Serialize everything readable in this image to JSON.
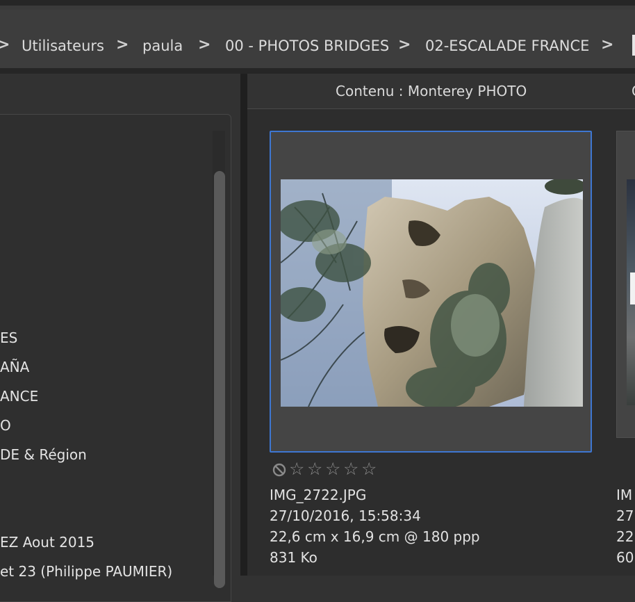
{
  "breadcrumb": {
    "items": [
      "Utilisateurs",
      "paula",
      "00 - PHOTOS BRIDGES",
      "02-ESCALADE FRANCE"
    ],
    "separator": ">"
  },
  "folders": {
    "items": [
      "ES",
      "AÑA",
      "ANCE",
      "O",
      "DE & Région",
      "EZ Aout 2015",
      "et 23  (Philippe PAUMIER)"
    ]
  },
  "content": {
    "title": "Contenu : Monterey PHOTO",
    "title_next": "C"
  },
  "thumbnail": {
    "filename": "IMG_2722.JPG",
    "date": "27/10/2016, 15:58:34",
    "dimensions": "22,6 cm x 16,9 cm @ 180 ppp",
    "size": "831 Ko",
    "rating": 0,
    "max_rating": 5,
    "star_glyph": "☆"
  },
  "thumbnail_next": {
    "filename": "IM",
    "date": "27",
    "dimensions": "22",
    "size": "60"
  },
  "colors": {
    "selection": "#3e77d2",
    "background": "#323232"
  }
}
